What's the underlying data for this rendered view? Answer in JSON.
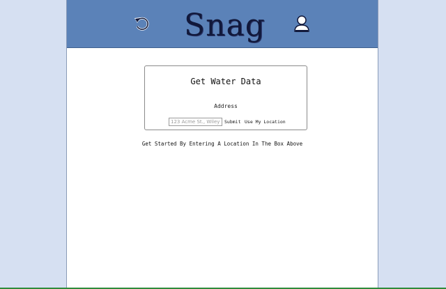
{
  "header": {
    "logo_text": "Snag",
    "refresh_icon": "refresh-icon",
    "user_icon": "user-icon",
    "background_color": "#5b82b8"
  },
  "card": {
    "title": "Get Water Data",
    "address_label": "Address",
    "address_placeholder": "123 Acme St., Wiley City",
    "address_value": "",
    "submit_label": "Submit",
    "use_location_label": "Use My Location"
  },
  "main": {
    "hint_text": "Get Started By Entering A Location In The Box Above"
  }
}
